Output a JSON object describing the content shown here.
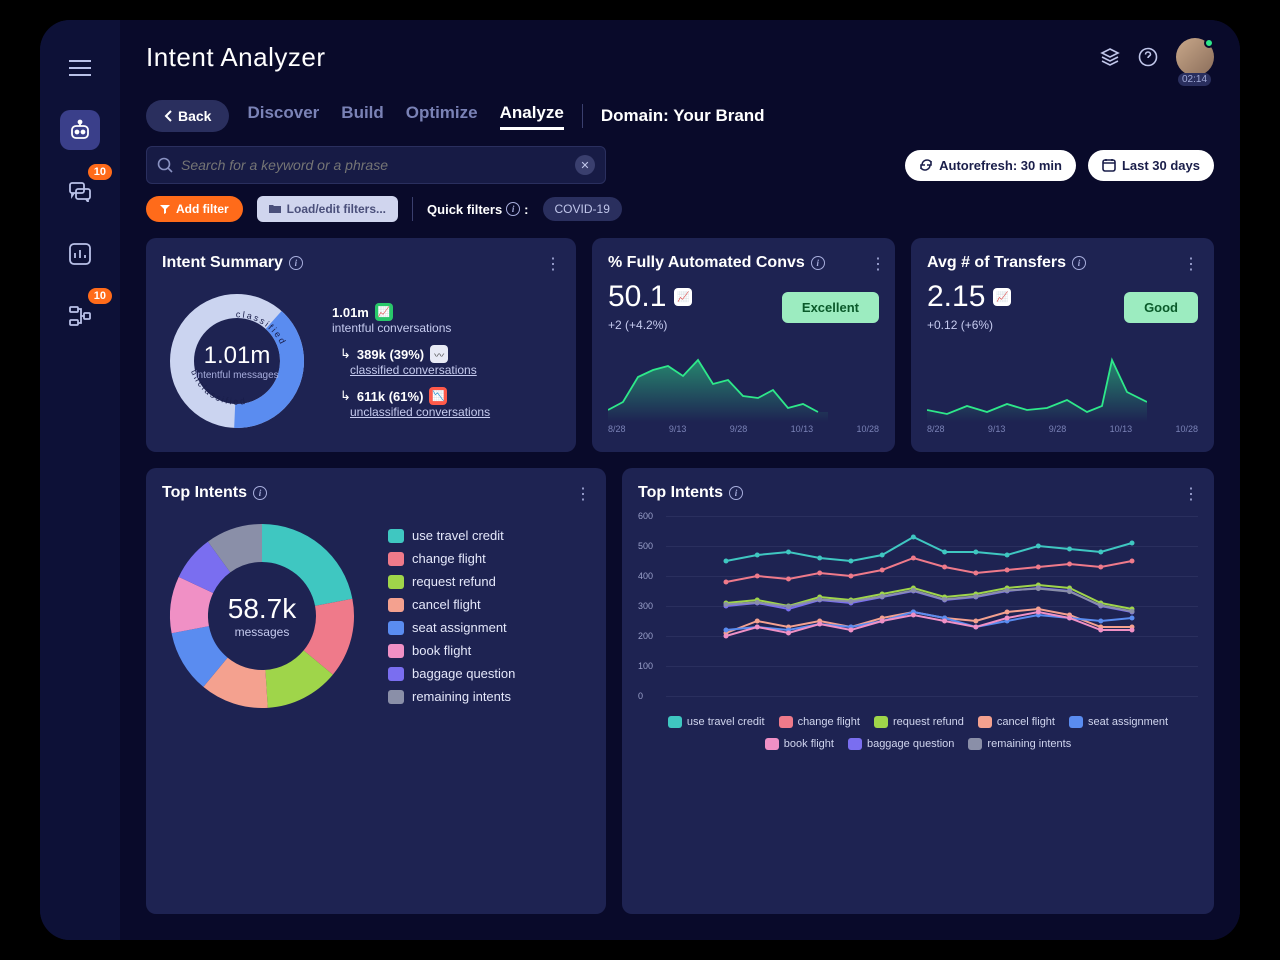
{
  "app": {
    "title": "Intent Analyzer",
    "avatar_time": "02:14"
  },
  "sidebar": {
    "items": [
      {
        "name": "menu"
      },
      {
        "name": "bot",
        "active": true
      },
      {
        "name": "chat",
        "badge": "10"
      },
      {
        "name": "analytics"
      },
      {
        "name": "flows",
        "badge": "10"
      }
    ]
  },
  "toolbar": {
    "back": "Back",
    "tabs": [
      "Discover",
      "Build",
      "Optimize",
      "Analyze"
    ],
    "active_tab": 3,
    "domain_label": "Domain: Your Brand"
  },
  "search": {
    "placeholder": "Search for a keyword or a phrase"
  },
  "controls": {
    "autorefresh": "Autorefresh: 30 min",
    "daterange": "Last 30 days",
    "add_filter": "Add filter",
    "load_filter": "Load/edit filters...",
    "quick_filters_label": "Quick filters",
    "quick_filters": [
      "COVID-19"
    ]
  },
  "intent_summary": {
    "title": "Intent Summary",
    "center_value": "1.01m",
    "center_label": "intentful\nmessages",
    "arc_classified": "classified",
    "arc_unclassified": "unclassified",
    "total_value": "1.01m",
    "total_label": "intentful conversations",
    "classified_value": "389k (39%)",
    "classified_label": "classified conversations",
    "unclassified_value": "611k (61%)",
    "unclassified_label": "unclassified conversations"
  },
  "automation": {
    "title": "% Fully Automated Convs",
    "value": "50.1",
    "delta": "+2 (+4.2%)",
    "quality": "Excellent",
    "xlabels": [
      "8/28",
      "9/13",
      "9/28",
      "10/13",
      "10/28"
    ]
  },
  "transfers": {
    "title": "Avg # of Transfers",
    "value": "2.15",
    "delta": "+0.12 (+6%)",
    "quality": "Good",
    "xlabels": [
      "8/28",
      "9/13",
      "9/28",
      "10/13",
      "10/28"
    ]
  },
  "top_intents_donut": {
    "title": "Top Intents",
    "center_value": "58.7k",
    "center_label": "messages",
    "legend": [
      {
        "label": "use travel credit",
        "color": "#3fc7c1"
      },
      {
        "label": "change flight",
        "color": "#ef7a8a"
      },
      {
        "label": "request refund",
        "color": "#9fd54a"
      },
      {
        "label": "cancel flight",
        "color": "#f4a18f"
      },
      {
        "label": "seat assignment",
        "color": "#5a8cf0"
      },
      {
        "label": "book flight",
        "color": "#f090c5"
      },
      {
        "label": "baggage question",
        "color": "#7a6ef0"
      },
      {
        "label": "remaining intents",
        "color": "#8a8fa8"
      }
    ]
  },
  "top_intents_lines": {
    "title": "Top Intents",
    "yticks": [
      "0",
      "100",
      "200",
      "300",
      "400",
      "500",
      "600"
    ]
  },
  "chart_data": [
    {
      "type": "pie",
      "title": "Intent Summary",
      "categories": [
        "classified",
        "unclassified"
      ],
      "values": [
        389000,
        611000
      ],
      "total_label": "1.01m intentful messages"
    },
    {
      "type": "area",
      "title": "% Fully Automated Convs",
      "ylim": [
        0,
        60
      ],
      "x": [
        "8/28",
        "9/3",
        "9/8",
        "9/13",
        "9/18",
        "9/23",
        "9/28",
        "10/3",
        "10/8",
        "10/13",
        "10/18",
        "10/23",
        "10/28"
      ],
      "values": [
        12,
        18,
        35,
        40,
        44,
        36,
        48,
        30,
        33,
        22,
        20,
        26,
        12
      ]
    },
    {
      "type": "area",
      "title": "Avg # of Transfers",
      "ylim": [
        0,
        4
      ],
      "x": [
        "8/28",
        "9/3",
        "9/8",
        "9/13",
        "9/18",
        "9/23",
        "9/28",
        "10/3",
        "10/8",
        "10/13",
        "10/18",
        "10/23",
        "10/28"
      ],
      "values": [
        0.8,
        0.6,
        1.0,
        0.7,
        1.1,
        0.9,
        0.8,
        1.2,
        0.9,
        0.7,
        1.0,
        3.2,
        1.4
      ]
    },
    {
      "type": "pie",
      "title": "Top Intents (donut)",
      "categories": [
        "use travel credit",
        "change flight",
        "request refund",
        "cancel flight",
        "seat assignment",
        "book flight",
        "baggage question",
        "remaining intents"
      ],
      "values": [
        22,
        14,
        13,
        12,
        11,
        10,
        8,
        10
      ],
      "total_label": "58.7k messages"
    },
    {
      "type": "line",
      "title": "Top Intents (trend)",
      "ylim": [
        0,
        600
      ],
      "x": [
        1,
        2,
        3,
        4,
        5,
        6,
        7,
        8,
        9,
        10,
        11,
        12,
        13,
        14
      ],
      "series": [
        {
          "name": "use travel credit",
          "color": "#3fc7c1",
          "values": [
            450,
            470,
            480,
            460,
            450,
            470,
            530,
            480,
            480,
            470,
            500,
            490,
            480,
            510
          ]
        },
        {
          "name": "change flight",
          "color": "#ef7a8a",
          "values": [
            380,
            400,
            390,
            410,
            400,
            420,
            460,
            430,
            410,
            420,
            430,
            440,
            430,
            450
          ]
        },
        {
          "name": "request refund",
          "color": "#9fd54a",
          "values": [
            310,
            320,
            300,
            330,
            320,
            340,
            360,
            330,
            340,
            360,
            370,
            360,
            310,
            290
          ]
        },
        {
          "name": "cancel flight",
          "color": "#f4a18f",
          "values": [
            210,
            250,
            230,
            250,
            230,
            260,
            280,
            260,
            250,
            280,
            290,
            270,
            230,
            230
          ]
        },
        {
          "name": "seat assignment",
          "color": "#5a8cf0",
          "values": [
            220,
            230,
            220,
            240,
            230,
            250,
            280,
            260,
            230,
            250,
            270,
            260,
            250,
            260
          ]
        },
        {
          "name": "book flight",
          "color": "#f090c5",
          "values": [
            200,
            230,
            210,
            240,
            220,
            250,
            270,
            250,
            230,
            260,
            280,
            260,
            220,
            220
          ]
        },
        {
          "name": "baggage question",
          "color": "#7a6ef0",
          "values": [
            300,
            310,
            290,
            320,
            310,
            330,
            350,
            320,
            330,
            350,
            360,
            350,
            300,
            280
          ]
        },
        {
          "name": "remaining intents",
          "color": "#8a8fa8",
          "values": [
            305,
            312,
            298,
            322,
            315,
            332,
            352,
            322,
            332,
            352,
            358,
            348,
            302,
            282
          ]
        }
      ]
    }
  ]
}
